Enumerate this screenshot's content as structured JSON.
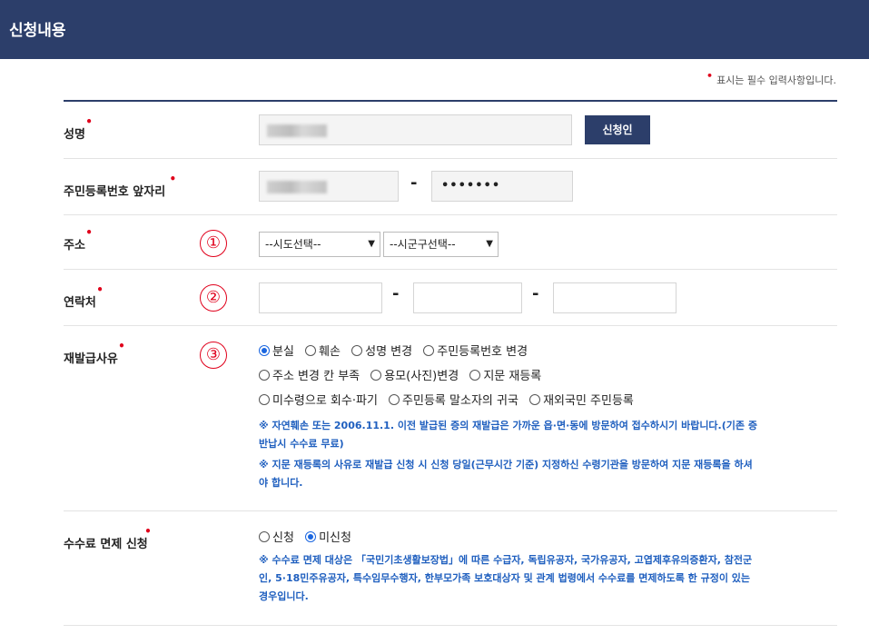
{
  "header": {
    "title": "신청내용"
  },
  "notice": {
    "marker": "•",
    "text": "표시는 필수 입력사항입니다."
  },
  "rows": {
    "name": {
      "label": "성명",
      "button": "신청인"
    },
    "rrn": {
      "label": "주민등록번호 앞자리",
      "separator": "-",
      "back_value": "•••••••"
    },
    "address": {
      "label": "주소",
      "step": "①",
      "sido": "--시도선택--",
      "sigungu": "--시군구선택--"
    },
    "contact": {
      "label": "연락처",
      "step": "②",
      "separator": "-"
    },
    "reason": {
      "label": "재발급사유",
      "step": "③",
      "options": [
        "분실",
        "훼손",
        "성명 변경",
        "주민등록번호 변경",
        "주소 변경 칸 부족",
        "용모(사진)변경",
        "지문 재등록",
        "미수령으로 회수·파기",
        "주민등록 말소자의 귀국",
        "재외국민 주민등록"
      ],
      "selected": "분실",
      "note1_line1": "※ 자연훼손 또는 2006.11.1. 이전 발급된 증의 재발급은 가까운 읍·면·동에 방문하여 접수하시기 바랍니다.(기존 증",
      "note1_line2": "반납시 수수료 무료)",
      "note2_line1": "※ 지문 재등록의 사유로 재발급 신청 시 신청 당일(근무시간 기준) 지정하신 수령기관을 방문하여 지문 재등록을 하셔",
      "note2_line2": "야 합니다."
    },
    "fee": {
      "label": "수수료 면제 신청",
      "options": [
        "신청",
        "미신청"
      ],
      "selected": "미신청",
      "note_line1": "※ 수수료 면제 대상은 「국민기초생활보장법」에 따른 수급자, 독립유공자, 국가유공자, 고엽제후유의증환자, 참전군",
      "note_line2": "인, 5·18민주유공자, 특수임무수행자, 한부모가족 보호대상자 및 관계 법령에서 수수료를 면제하도록 한 규정이 있는",
      "note_line3": "경우입니다."
    }
  },
  "colors": {
    "header": "#2c3e6a",
    "required": "#e0001b",
    "note": "#1f5fbf",
    "radio": "#1a66e0"
  }
}
